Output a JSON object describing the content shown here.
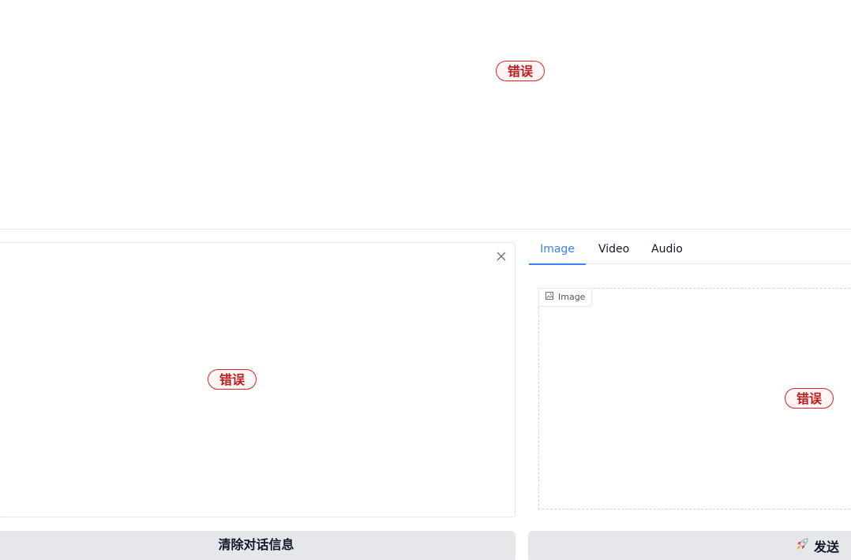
{
  "chatbot": {
    "error_label": "错误"
  },
  "text_input": {
    "error_label": "错误"
  },
  "media_input": {
    "tabs": [
      {
        "label": "Image",
        "active": true
      },
      {
        "label": "Video",
        "active": false
      },
      {
        "label": "Audio",
        "active": false
      }
    ],
    "image_label": "Image",
    "error_label": "错误"
  },
  "actions": {
    "clear_label": "清除对话信息",
    "send_label": "发送",
    "send_icon": "rocket-icon"
  },
  "colors": {
    "accent": "#3b82f6",
    "error": "#dc2626",
    "button_bg": "#e5e7eb"
  }
}
